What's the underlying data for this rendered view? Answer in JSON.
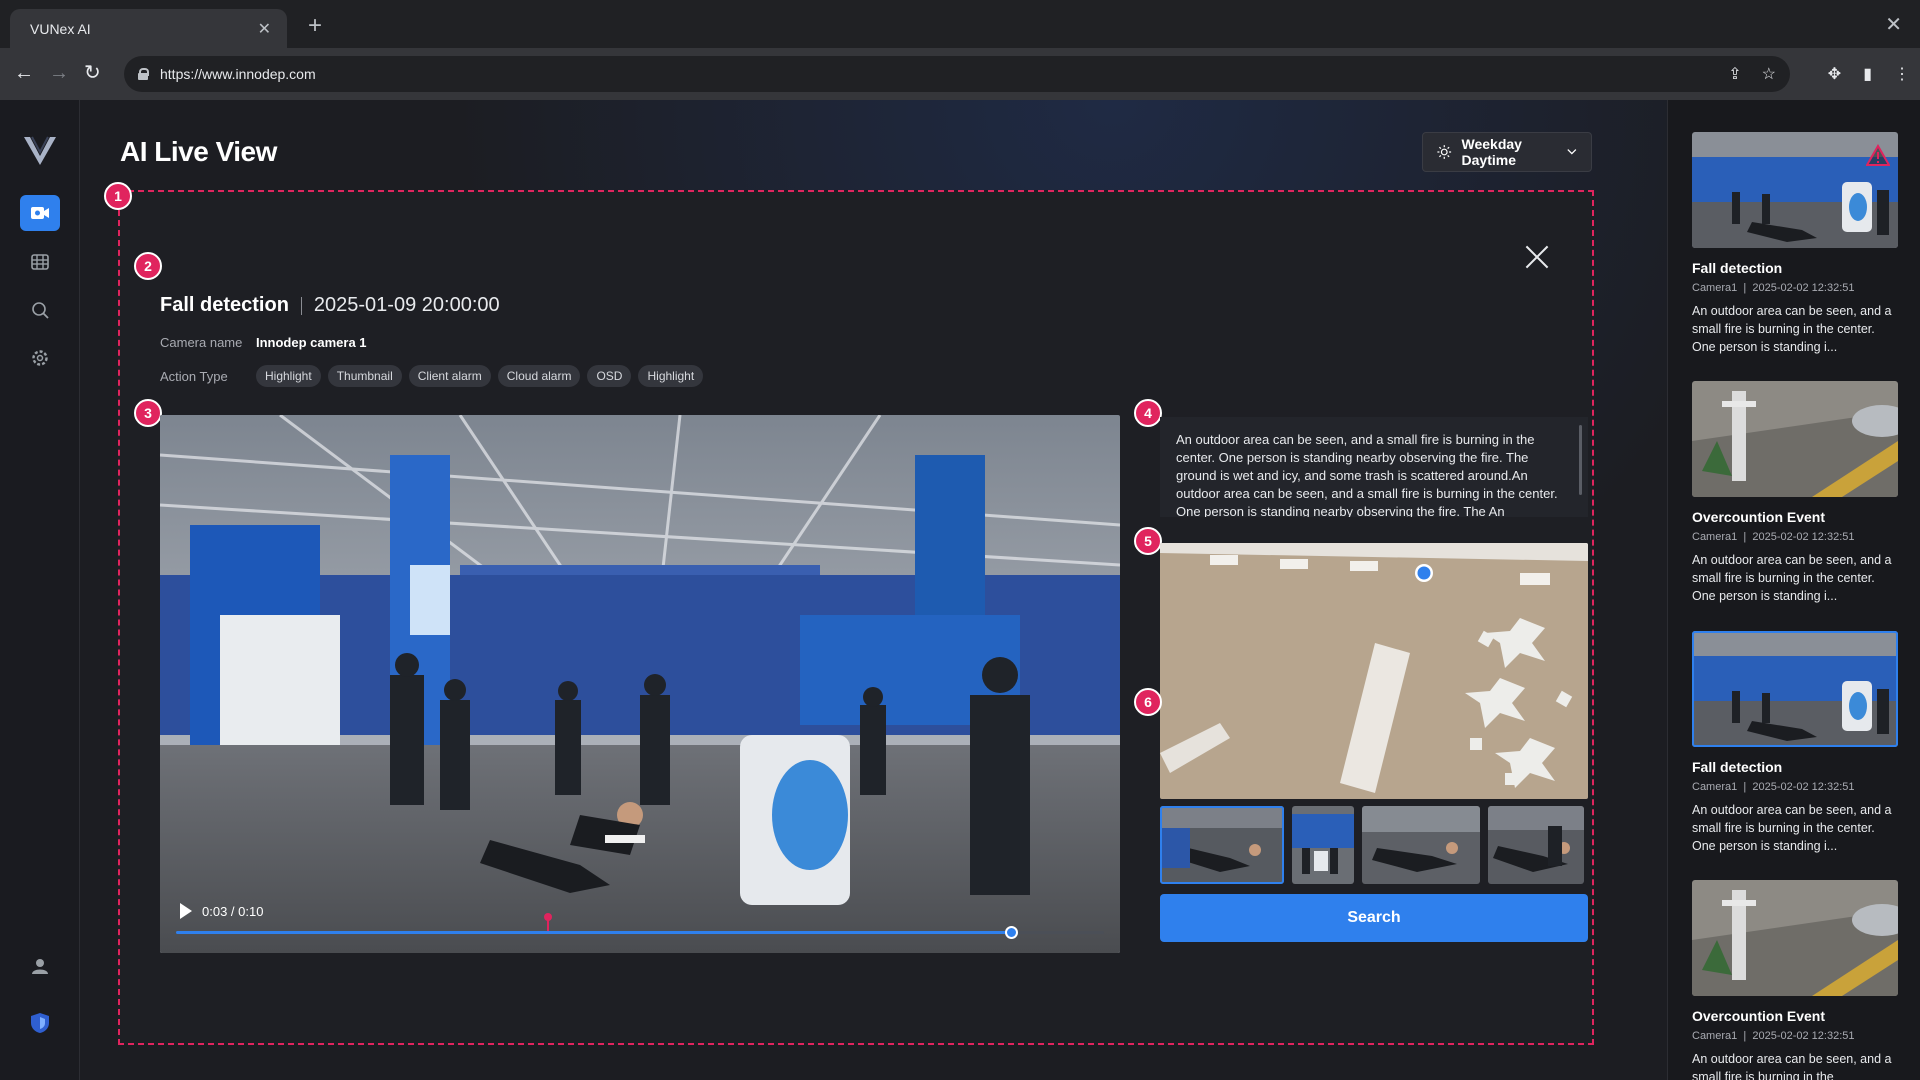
{
  "browser": {
    "tab_title": "VUNex AI",
    "url": "https://www.innodep.com"
  },
  "page": {
    "title": "AI Live View",
    "schedule_label": "Weekday Daytime"
  },
  "badges": [
    "1",
    "2",
    "3",
    "4",
    "5",
    "6"
  ],
  "event": {
    "name": "Fall detection",
    "datetime": "2025-01-09 20:00:00",
    "camera_label": "Camera name",
    "camera_value": "Innodep camera 1",
    "action_label": "Action Type",
    "actions": [
      "Highlight",
      "Thumbnail",
      "Client alarm",
      "Cloud alarm",
      "OSD",
      "Highlight"
    ]
  },
  "player": {
    "time": "0:03 / 0:10",
    "progress": 0.9,
    "marker": 0.4
  },
  "description": "An outdoor area can be seen, and a small fire is burning in the center. One person is standing nearby observing the fire. The ground is wet and icy, and some trash is scattered around.An outdoor area can be seen, and a small fire is burning in the center. One person is standing nearby observing the fire. The An",
  "search_label": "Search",
  "event_list": [
    {
      "name": "Fall detection",
      "camera": "Camera1",
      "time": "2025-02-02 12:32:51",
      "text": "An outdoor area can be seen, and a small fire is burning in the center. One person is standing i..."
    },
    {
      "name": "Overcountion Event",
      "camera": "Camera1",
      "time": "2025-02-02 12:32:51",
      "text": "An outdoor area can be seen, and a small fire is burning in the center. One person is standing i..."
    },
    {
      "name": "Fall detection",
      "camera": "Camera1",
      "time": "2025-02-02 12:32:51",
      "text": "An outdoor area can be seen, and a small fire is burning in the center. One person is standing i..."
    },
    {
      "name": "Overcountion Event",
      "camera": "Camera1",
      "time": "2025-02-02 12:32:51",
      "text": "An outdoor area can be seen, and a small fire is burning in the"
    }
  ],
  "colors": {
    "accent": "#2f80ed",
    "badge": "#e0245e"
  }
}
